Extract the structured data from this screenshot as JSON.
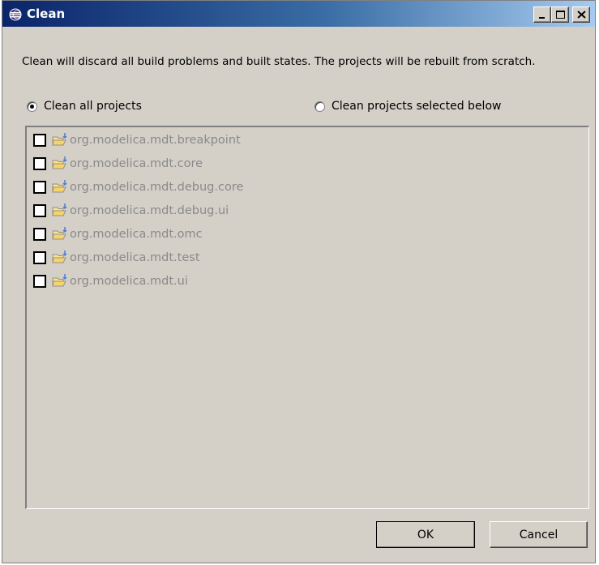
{
  "window": {
    "title": "Clean",
    "controls": {
      "minimize": "minimize",
      "maximize": "maximize",
      "close": "close"
    }
  },
  "description": "Clean will discard all build problems and built states.  The projects will be rebuilt from scratch.",
  "options": {
    "clean_all": {
      "label": "Clean all projects",
      "selected": true
    },
    "clean_selected": {
      "label": "Clean projects selected below",
      "selected": false
    }
  },
  "projects": [
    {
      "label": "org.modelica.mdt.breakpoint",
      "checked": false
    },
    {
      "label": "org.modelica.mdt.core",
      "checked": false
    },
    {
      "label": "org.modelica.mdt.debug.core",
      "checked": false
    },
    {
      "label": "org.modelica.mdt.debug.ui",
      "checked": false
    },
    {
      "label": "org.modelica.mdt.omc",
      "checked": false
    },
    {
      "label": "org.modelica.mdt.test",
      "checked": false
    },
    {
      "label": "org.modelica.mdt.ui",
      "checked": false
    }
  ],
  "buttons": {
    "ok": "OK",
    "cancel": "Cancel"
  },
  "icons": {
    "app": "eclipse-icon",
    "project": "project-folder-icon"
  },
  "colors": {
    "titlebar_start": "#0a246a",
    "titlebar_end": "#a6caf0",
    "dialog_bg": "#d4d0c8",
    "disabled_text": "#8a8a8a"
  }
}
